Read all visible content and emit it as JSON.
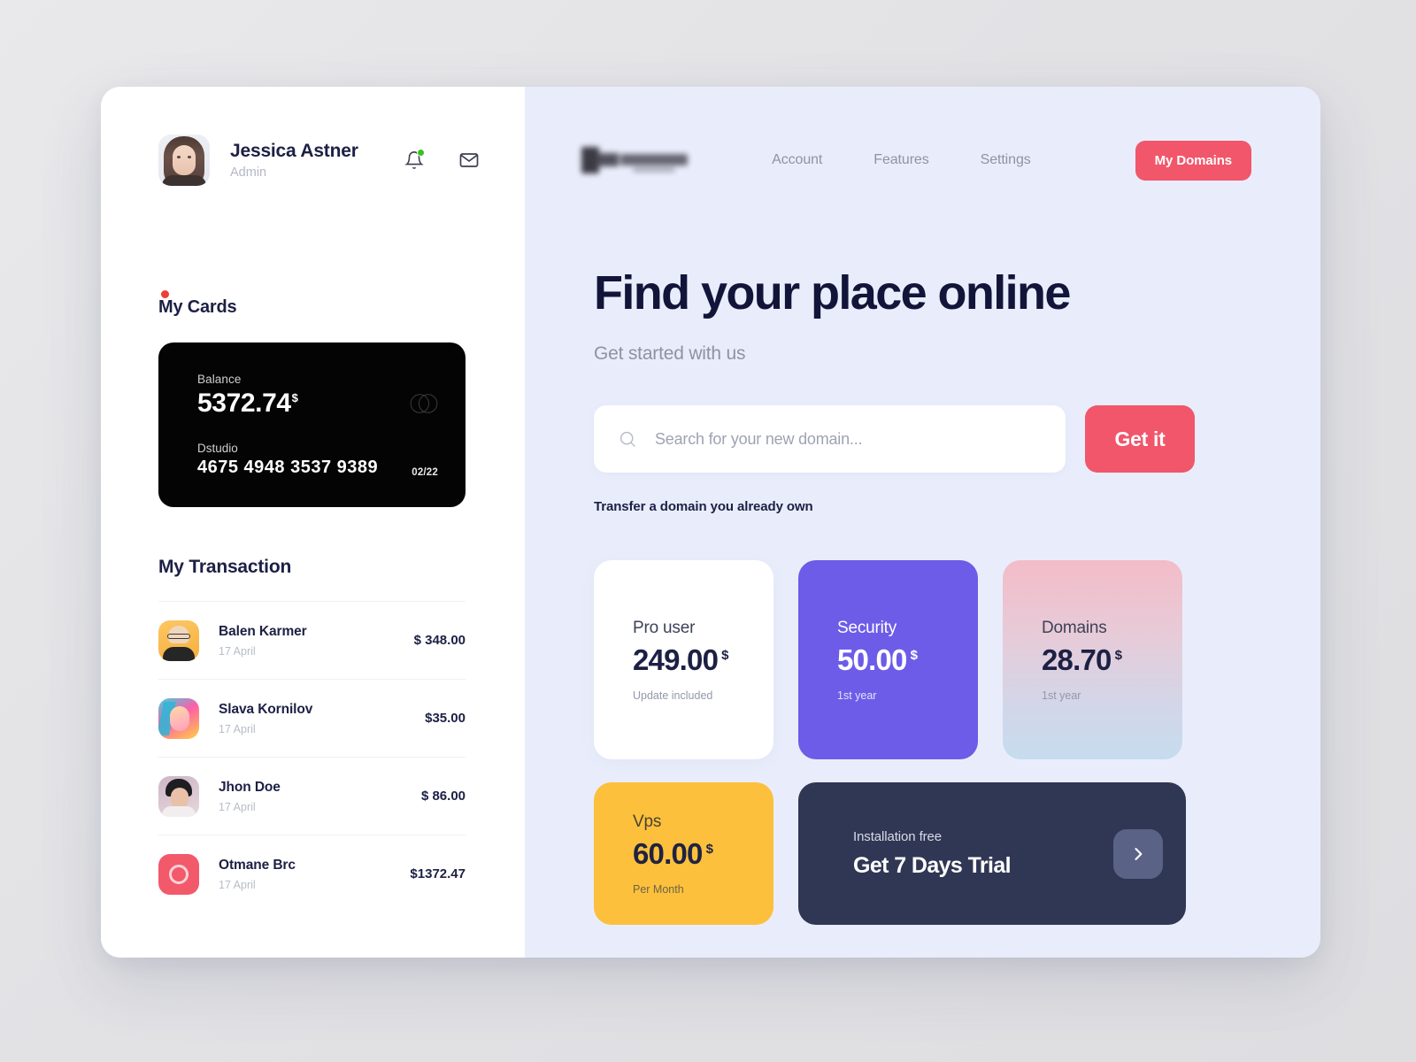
{
  "sidebar": {
    "profile": {
      "name": "Jessica Astner",
      "role": "Admin"
    },
    "icons": {
      "bell": "bell-icon",
      "mail": "mail-icon"
    },
    "cards_section": {
      "title": "My Cards"
    },
    "credit_card": {
      "balance_label": "Balance",
      "balance": "5372.74",
      "currency": "$",
      "brand": "Dstudio",
      "number": "4675 4948 3537 9389",
      "expiry": "02/22"
    },
    "transactions_section": {
      "title": "My Transaction"
    },
    "transactions": [
      {
        "name": "Balen Karmer",
        "date": "17 April",
        "amount": "$ 348.00"
      },
      {
        "name": "Slava Kornilov",
        "date": "17 April",
        "amount": "$35.00"
      },
      {
        "name": "Jhon Doe",
        "date": "17 April",
        "amount": "$ 86.00"
      },
      {
        "name": "Otmane Brc",
        "date": "17 April",
        "amount": "$1372.47"
      }
    ]
  },
  "main": {
    "nav": {
      "items": [
        "Account",
        "Features",
        "Settings"
      ],
      "cta": "My Domains"
    },
    "hero": {
      "title": "Find your place online",
      "subtitle": "Get started with us"
    },
    "search": {
      "placeholder": "Search for your new domain...",
      "value": "",
      "button": "Get it"
    },
    "transfer_link": "Transfer a domain you already own",
    "tiles": [
      {
        "name": "Pro user",
        "price": "249.00",
        "currency": "$",
        "note": "Update included"
      },
      {
        "name": "Security",
        "price": "50.00",
        "currency": "$",
        "note": "1st year"
      },
      {
        "name": "Domains",
        "price": "28.70",
        "currency": "$",
        "note": "1st year"
      },
      {
        "name": "Vps",
        "price": "60.00",
        "currency": "$",
        "note": "Per Month"
      }
    ],
    "trial": {
      "eyebrow": "Installation free",
      "title": "Get 7 Days Trial",
      "arrow": "chevron-right-icon"
    }
  },
  "colors": {
    "accent_red": "#f1566a",
    "purple": "#6c5ce8",
    "yellow": "#fcc03c",
    "dark_slate": "#303754",
    "panel_bg": "#e9edfb",
    "ink": "#1c2044",
    "badge_green": "#37c11e"
  }
}
